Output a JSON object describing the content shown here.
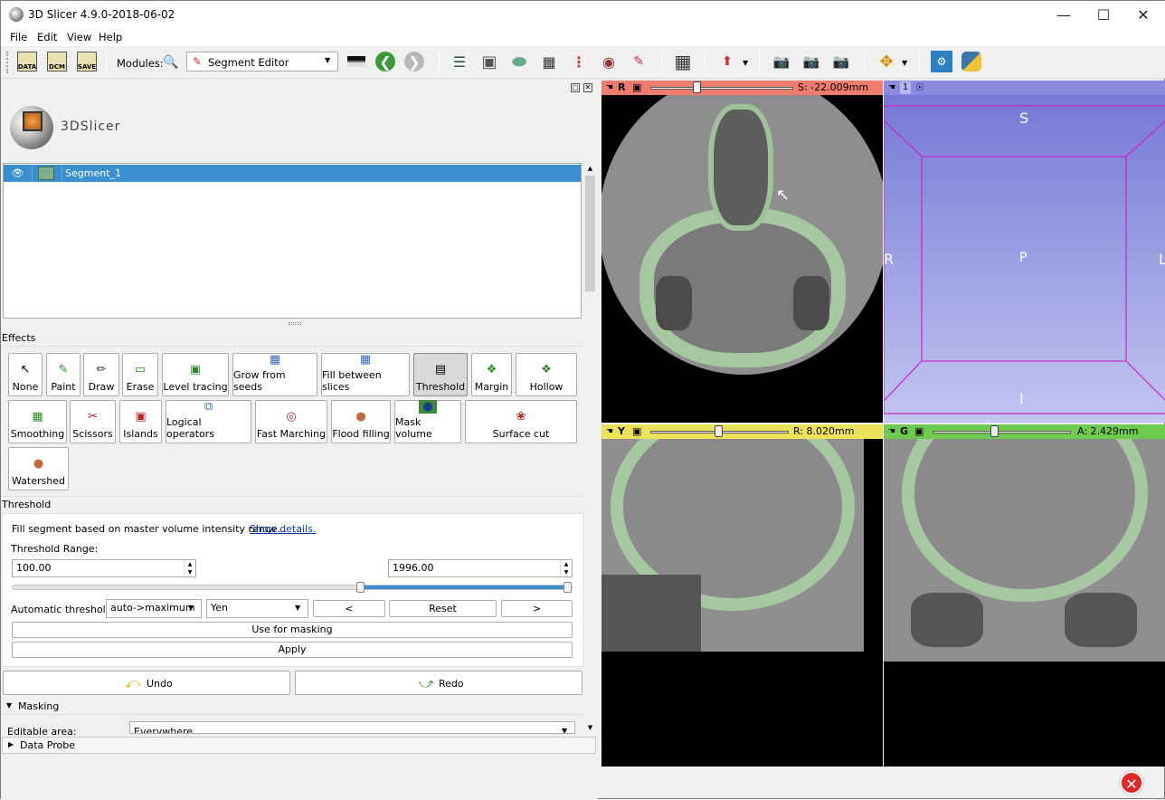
{
  "window": {
    "title": "3D Slicer 4.9.0-2018-06-02"
  },
  "menu": [
    "File",
    "Edit",
    "View",
    "Help"
  ],
  "toolbar": {
    "data_label": "DATA",
    "dcm_label": "DCM",
    "save_label": "SAVE",
    "modules_label": "Modules:",
    "module_selected": "Segment Editor"
  },
  "logo": {
    "text": "3DSlicer"
  },
  "segments": [
    {
      "name": "Segment_1",
      "color": "#7fb08a"
    }
  ],
  "effects_label": "Effects",
  "effects": [
    "None",
    "Paint",
    "Draw",
    "Erase",
    "Level tracing",
    "Grow from seeds",
    "Fill between slices",
    "Threshold",
    "Margin",
    "Hollow",
    "Smoothing",
    "Scissors",
    "Islands",
    "Logical operators",
    "Fast Marching",
    "Flood filling",
    "Mask volume",
    "Surface cut",
    "Watershed"
  ],
  "threshold": {
    "section_title": "Threshold",
    "description": "Fill segment based on master volume intensity range...",
    "show_details": "Show details.",
    "range_label": "Threshold Range:",
    "min_value": "100.00",
    "max_value": "1996.00",
    "auto_label": "Automatic threshold:",
    "auto_mode": "auto->maximum",
    "auto_method": "Yen",
    "prev": "<",
    "reset": "Reset",
    "next": ">",
    "use_for_masking": "Use for masking",
    "apply": "Apply"
  },
  "undo_label": "Undo",
  "redo_label": "Redo",
  "masking": {
    "title": "Masking",
    "editable_label": "Editable area:",
    "editable_value": "Everywhere"
  },
  "data_probe": "Data Probe",
  "views": {
    "red": {
      "letter": "R",
      "value": "S: -22.009mm",
      "color": "#f07c70"
    },
    "threed": {
      "number": "1",
      "labels": {
        "top": "S",
        "bottom": "I",
        "left": "R",
        "right": "L",
        "center": "P"
      }
    },
    "yellow": {
      "letter": "Y",
      "value": "R: 8.020mm",
      "color": "#ece35a"
    },
    "green": {
      "letter": "G",
      "value": "A: 2.429mm",
      "color": "#6ecb4f"
    }
  }
}
